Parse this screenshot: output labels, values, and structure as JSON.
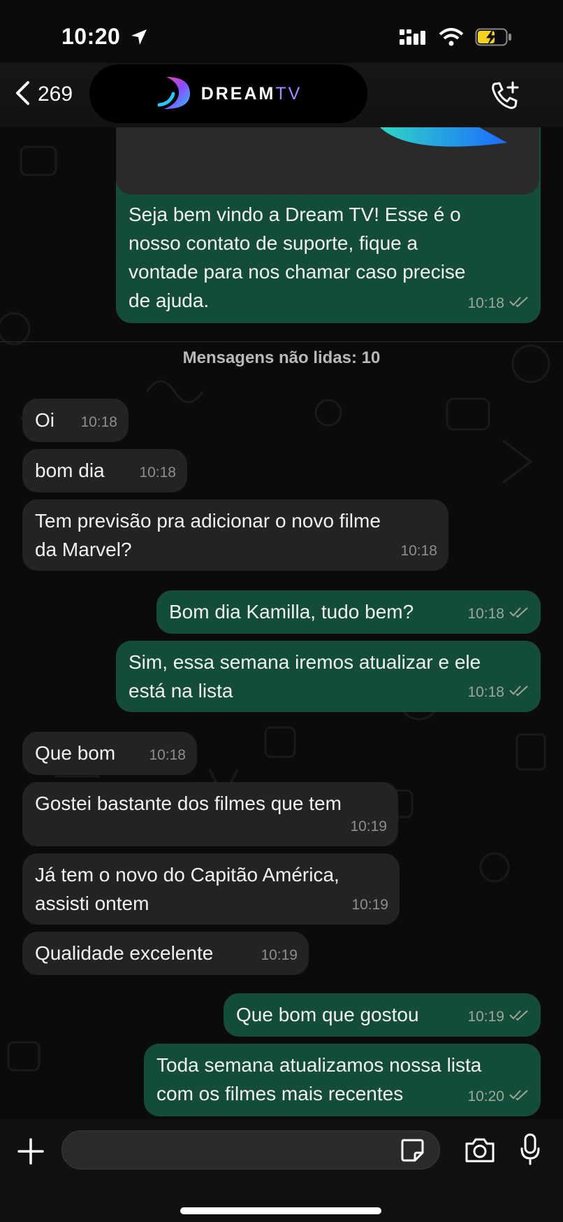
{
  "status_bar": {
    "time": "10:20"
  },
  "header": {
    "back_count": "269",
    "brand_main": "DREAM",
    "brand_tv": "TV"
  },
  "messages": [
    {
      "dir": "out",
      "text": "Seja bem vindo a Dream TV!      Esse é o\nnosso contato de suporte, fique a\nvontade para nos chamar caso precise\nde ajuda.",
      "time": "10:18"
    },
    {
      "dir": "in",
      "text": "Oi",
      "time": "10:18"
    },
    {
      "dir": "in",
      "text": "bom dia",
      "time": "10:18"
    },
    {
      "dir": "in",
      "text": "Tem previsão pra adicionar o novo filme\nda Marvel?",
      "time": "10:18"
    },
    {
      "dir": "out",
      "text": "Bom dia Kamilla, tudo bem?",
      "time": "10:18"
    },
    {
      "dir": "out",
      "text": "Sim, essa semana iremos atualizar e ele\nestá na lista",
      "time": "10:18"
    },
    {
      "dir": "in",
      "text": "Que bom",
      "time": "10:18"
    },
    {
      "dir": "in",
      "text": "Gostei bastante dos filmes que tem",
      "time": "10:19"
    },
    {
      "dir": "in",
      "text": "Já tem o novo do Capitão América,\nassisti ontem",
      "time": "10:19"
    },
    {
      "dir": "in",
      "text": "Qualidade excelente",
      "time": "10:19"
    },
    {
      "dir": "out",
      "text": "Que bom que gostou",
      "time": "10:19"
    },
    {
      "dir": "out",
      "text": "Toda semana atualizamos nossa lista\ncom os filmes mais recentes",
      "time": "10:20"
    }
  ],
  "unread_divider": "Mensagens não lidas: 10",
  "input": {
    "placeholder": ""
  },
  "colors": {
    "incoming_bubble": "#232323",
    "outgoing_bubble": "#144d37",
    "background": "#0b0b0b"
  }
}
